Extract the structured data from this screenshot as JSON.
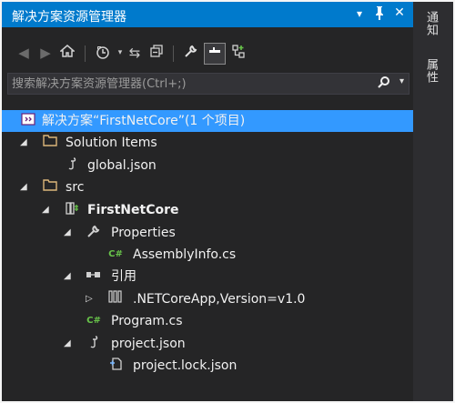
{
  "window": {
    "title": "解决方案资源管理器",
    "menu_glyph": "▾",
    "pin_glyph": "ᚽ",
    "close_glyph": "✕"
  },
  "toolbar": {
    "back_icon": "back-icon",
    "forward_icon": "forward-icon",
    "home_icon": "home-icon",
    "history_icon": "history-icon",
    "sync_icon": "sync-icon",
    "collapse_icon": "collapse-all-icon",
    "properties_icon": "properties-icon",
    "preview_icon": "preview-icon",
    "new_view_icon": "new-view-icon"
  },
  "search": {
    "placeholder": "搜索解决方案资源管理器(Ctrl+;)"
  },
  "tree": {
    "solution": "解决方案“FirstNetCore”(1 个项目)",
    "solution_items": "Solution Items",
    "global_json": "global.json",
    "src": "src",
    "project": "FirstNetCore",
    "properties": "Properties",
    "assemblyinfo": "AssemblyInfo.cs",
    "references": "引用",
    "netcoreapp": ".NETCoreApp,Version=v1.0",
    "program": "Program.cs",
    "project_json": "project.json",
    "project_lock_json": "project.lock.json"
  },
  "side_tabs": {
    "notifications": "通知",
    "properties": "属性"
  },
  "colors": {
    "accent": "#007acc",
    "selection": "#3399ff",
    "background": "#252526",
    "cs_green": "#68c44a",
    "folder": "#dcb67a"
  }
}
